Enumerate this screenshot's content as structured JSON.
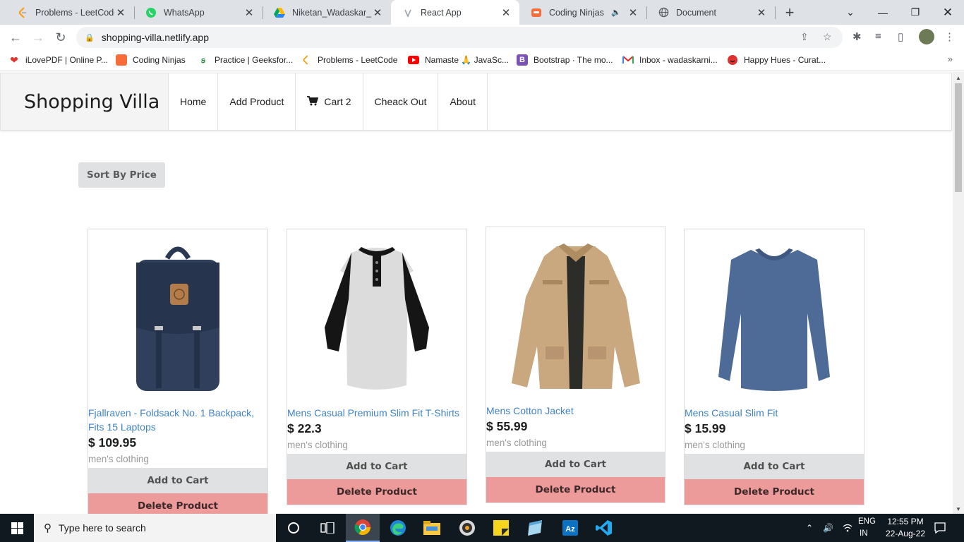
{
  "browser": {
    "tabs": [
      {
        "title": "Problems - LeetCode",
        "icon": "leetcode-icon"
      },
      {
        "title": "WhatsApp",
        "icon": "whatsapp-icon"
      },
      {
        "title": "Niketan_Wadaskar_Re",
        "icon": "google-drive-icon"
      },
      {
        "title": "React App",
        "icon": "react-icon"
      },
      {
        "title": "Coding Ninjas",
        "icon": "coding-ninjas-icon"
      },
      {
        "title": "Document",
        "icon": "globe-icon"
      }
    ],
    "url": "shopping-villa.netlify.app",
    "bookmarks": [
      {
        "label": "iLovePDF | Online P...",
        "icon": "ilovepdf-icon",
        "color": "#e5322d"
      },
      {
        "label": "Coding Ninjas",
        "icon": "coding-ninjas-icon",
        "color": "#f66c3b"
      },
      {
        "label": "Practice | Geeksfor...",
        "icon": "geeksforgeeks-icon",
        "color": "#2f8d46"
      },
      {
        "label": "Problems - LeetCode",
        "icon": "leetcode-icon",
        "color": "#ffa116"
      },
      {
        "label": "Namaste 🙏 JavaSc...",
        "icon": "youtube-icon",
        "color": "#ff0000"
      },
      {
        "label": "Bootstrap · The mo...",
        "icon": "bootstrap-icon",
        "color": "#7952b3"
      },
      {
        "label": "Inbox - wadaskarni...",
        "icon": "gmail-icon",
        "color": "#d93025"
      },
      {
        "label": "Happy Hues - Curat...",
        "icon": "happy-hues-icon",
        "color": "#e03131"
      }
    ]
  },
  "site": {
    "brand": "Shopping Villa",
    "nav": {
      "home": "Home",
      "add_product": "Add Product",
      "cart": "Cart 2",
      "checkout": "Cheack Out",
      "about": "About"
    },
    "sort_label": "Sort By Price",
    "products": [
      {
        "name": "Fjallraven - Foldsack No. 1 Backpack, Fits 15 Laptops",
        "price": "$ 109.95",
        "category": "men's clothing",
        "add_label": "Add to Cart",
        "delete_label": "Delete Product",
        "image": "navy-backpack"
      },
      {
        "name": "Mens Casual Premium Slim Fit T-Shirts",
        "price": "$ 22.3",
        "category": "men's clothing",
        "add_label": "Add to Cart",
        "delete_label": "Delete Product",
        "image": "raglan-tshirt"
      },
      {
        "name": "Mens Cotton Jacket",
        "price": "$ 55.99",
        "category": "men's clothing",
        "add_label": "Add to Cart",
        "delete_label": "Delete Product",
        "image": "khaki-jacket"
      },
      {
        "name": "Mens Casual Slim Fit",
        "price": "$ 15.99",
        "category": "men's clothing",
        "add_label": "Add to Cart",
        "delete_label": "Delete Product",
        "image": "blue-longsleeve"
      }
    ],
    "colors": {
      "link": "#4183c4",
      "delete_button": "#ec9a9a",
      "neutral_button": "#e0e1e2"
    }
  },
  "taskbar": {
    "search_placeholder": "Type here to search",
    "lang_line1": "ENG",
    "lang_line2": "IN",
    "time": "12:55 PM",
    "date": "22-Aug-22"
  }
}
